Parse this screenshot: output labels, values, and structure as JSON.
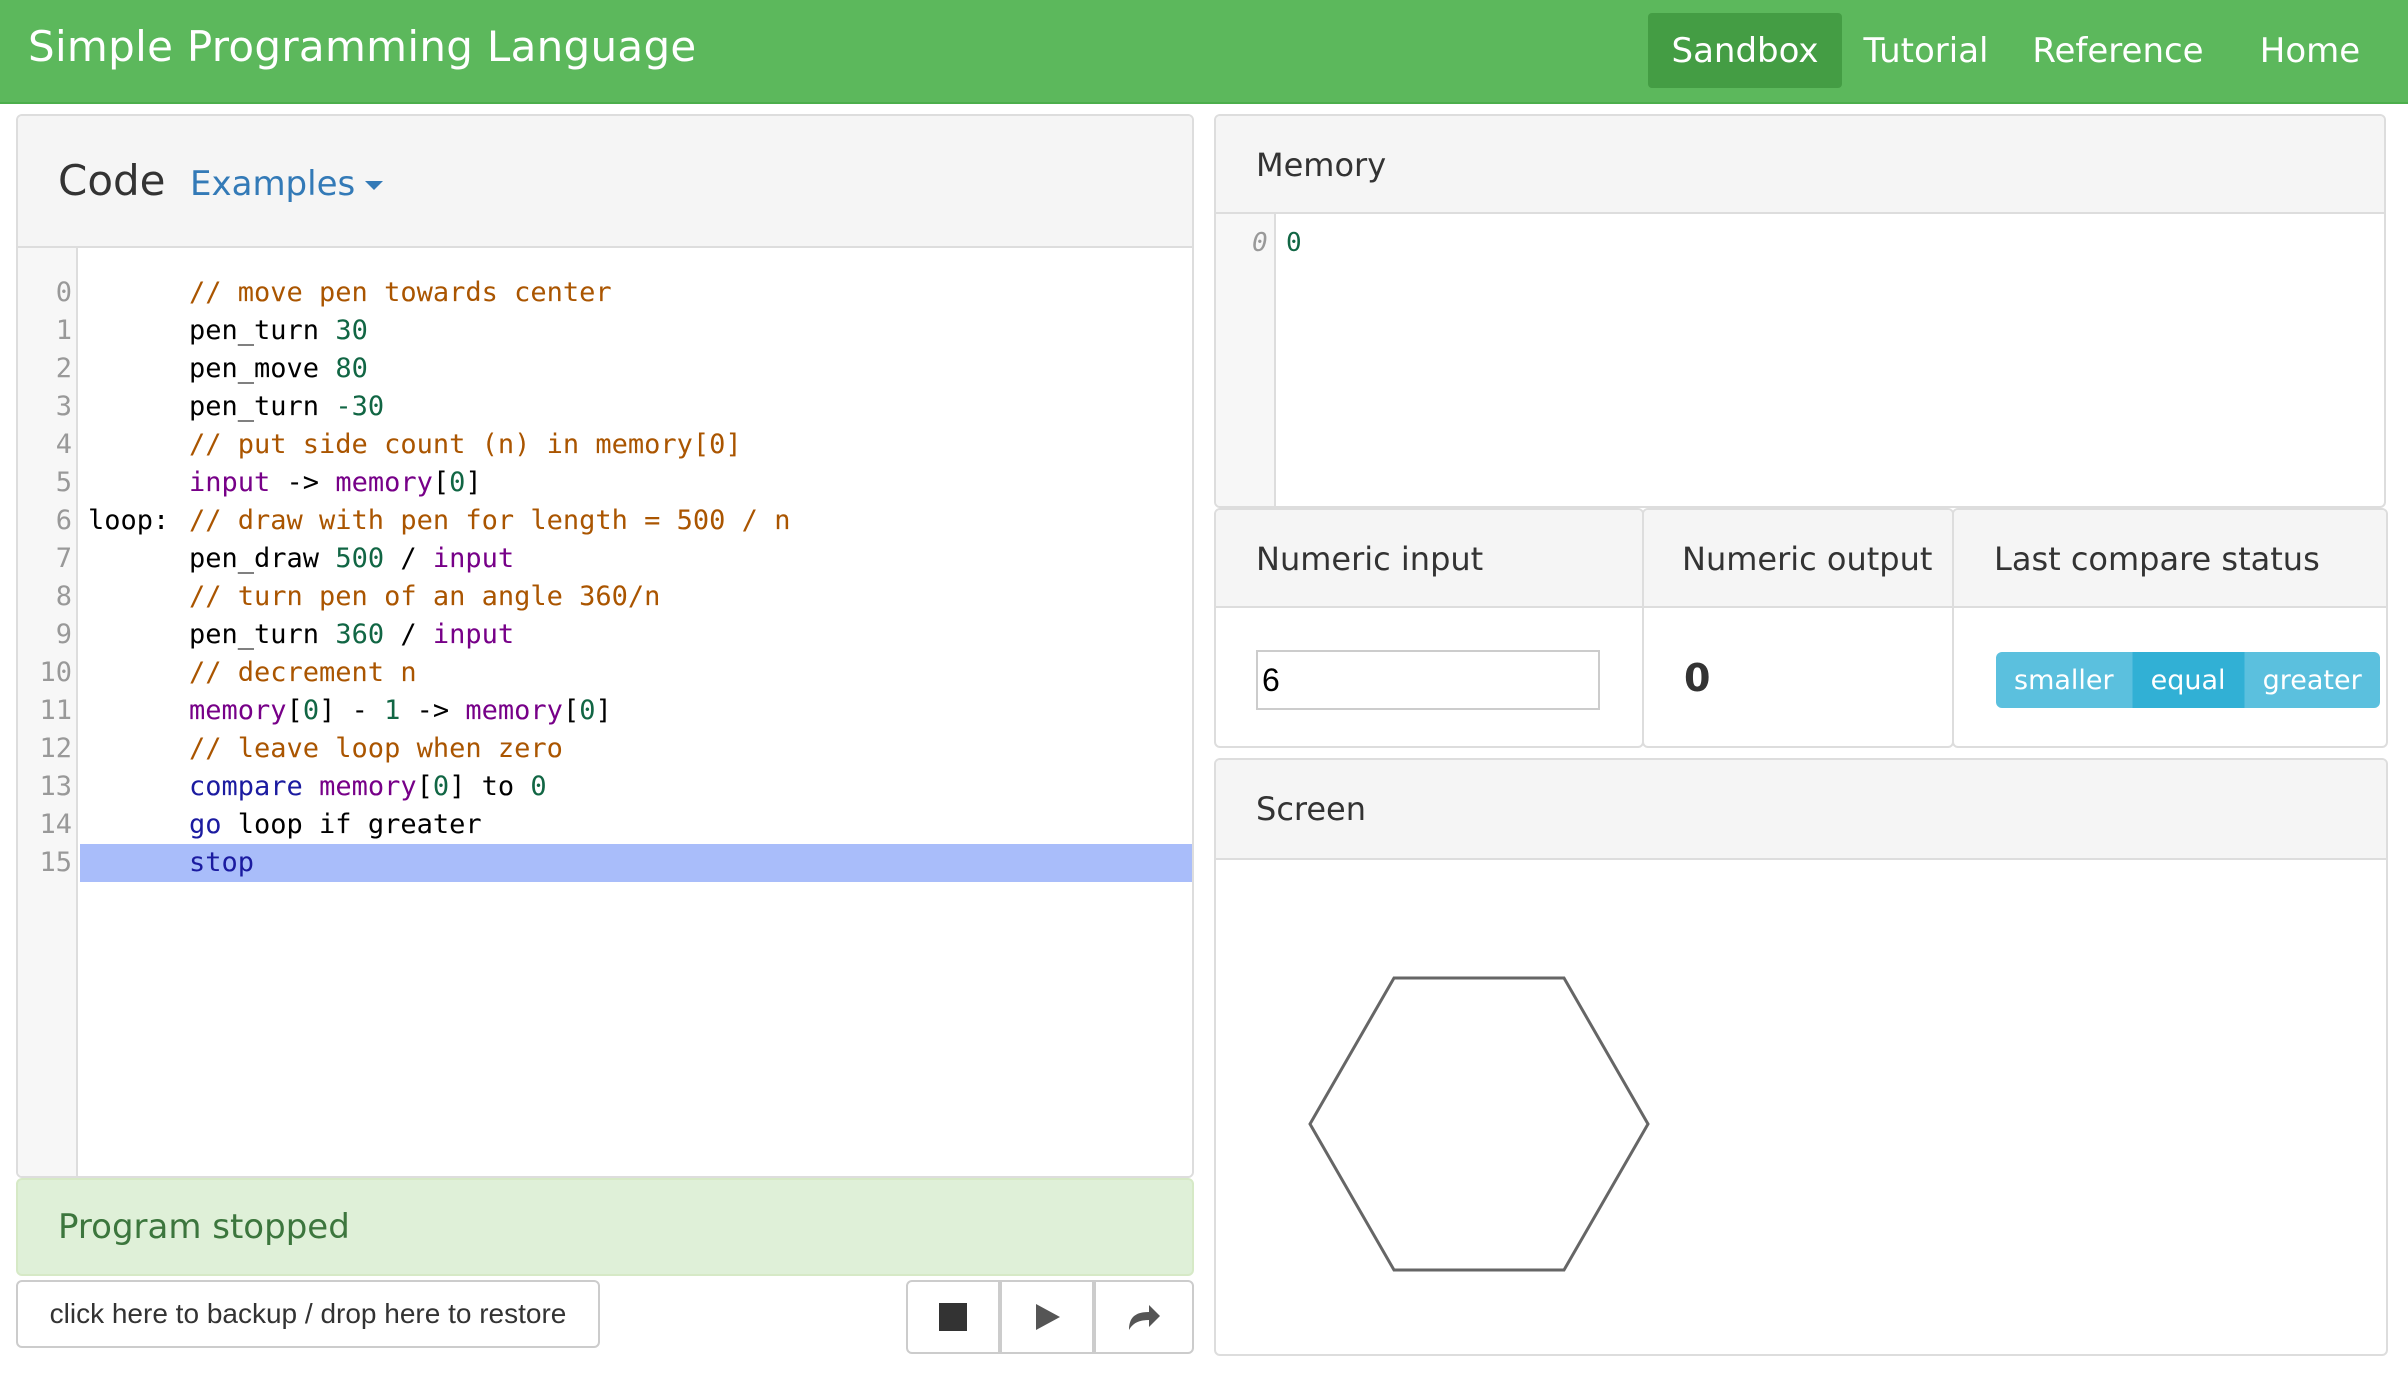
{
  "navbar": {
    "brand": "Simple Programming Language",
    "items": [
      {
        "label": "Sandbox",
        "active": true
      },
      {
        "label": "Tutorial",
        "active": false
      },
      {
        "label": "Reference",
        "active": false
      },
      {
        "label": "Home",
        "active": false
      }
    ]
  },
  "code_panel": {
    "title": "Code",
    "examples_label": "Examples",
    "current_line": 15,
    "lines": [
      {
        "num": "0",
        "label": "",
        "tokens": [
          [
            "comment",
            "// move pen towards center"
          ]
        ]
      },
      {
        "num": "1",
        "label": "",
        "tokens": [
          [
            "plain",
            "pen_turn "
          ],
          [
            "number",
            "30"
          ]
        ]
      },
      {
        "num": "2",
        "label": "",
        "tokens": [
          [
            "plain",
            "pen_move "
          ],
          [
            "number",
            "80"
          ]
        ]
      },
      {
        "num": "3",
        "label": "",
        "tokens": [
          [
            "plain",
            "pen_turn "
          ],
          [
            "number",
            "-30"
          ]
        ]
      },
      {
        "num": "4",
        "label": "",
        "tokens": [
          [
            "comment",
            "// put side count (n) in memory[0]"
          ]
        ]
      },
      {
        "num": "5",
        "label": "",
        "tokens": [
          [
            "var",
            "input"
          ],
          [
            "plain",
            " -> "
          ],
          [
            "var",
            "memory"
          ],
          [
            "plain",
            "["
          ],
          [
            "number",
            "0"
          ],
          [
            "plain",
            "]"
          ]
        ]
      },
      {
        "num": "6",
        "label": "loop:",
        "tokens": [
          [
            "comment",
            "// draw with pen for length = 500 / n"
          ]
        ]
      },
      {
        "num": "7",
        "label": "",
        "tokens": [
          [
            "plain",
            "pen_draw "
          ],
          [
            "number",
            "500"
          ],
          [
            "plain",
            " / "
          ],
          [
            "var",
            "input"
          ]
        ]
      },
      {
        "num": "8",
        "label": "",
        "tokens": [
          [
            "comment",
            "// turn pen of an angle 360/n"
          ]
        ]
      },
      {
        "num": "9",
        "label": "",
        "tokens": [
          [
            "plain",
            "pen_turn "
          ],
          [
            "number",
            "360"
          ],
          [
            "plain",
            " / "
          ],
          [
            "var",
            "input"
          ]
        ]
      },
      {
        "num": "10",
        "label": "",
        "tokens": [
          [
            "comment",
            "// decrement n"
          ]
        ]
      },
      {
        "num": "11",
        "label": "",
        "tokens": [
          [
            "var",
            "memory"
          ],
          [
            "plain",
            "["
          ],
          [
            "number",
            "0"
          ],
          [
            "plain",
            "] - "
          ],
          [
            "number",
            "1"
          ],
          [
            "plain",
            " -> "
          ],
          [
            "var",
            "memory"
          ],
          [
            "plain",
            "["
          ],
          [
            "number",
            "0"
          ],
          [
            "plain",
            "]"
          ]
        ]
      },
      {
        "num": "12",
        "label": "",
        "tokens": [
          [
            "comment",
            "// leave loop when zero"
          ]
        ]
      },
      {
        "num": "13",
        "label": "",
        "tokens": [
          [
            "keyword",
            "compare"
          ],
          [
            "plain",
            " "
          ],
          [
            "var",
            "memory"
          ],
          [
            "plain",
            "["
          ],
          [
            "number",
            "0"
          ],
          [
            "plain",
            "] to "
          ],
          [
            "number",
            "0"
          ]
        ]
      },
      {
        "num": "14",
        "label": "",
        "tokens": [
          [
            "keyword",
            "go"
          ],
          [
            "plain",
            " loop if greater"
          ]
        ]
      },
      {
        "num": "15",
        "label": "",
        "tokens": [
          [
            "keyword",
            "stop"
          ]
        ]
      }
    ]
  },
  "status": {
    "text": "Program stopped"
  },
  "controls": {
    "backup_label": "click here to backup / drop here to restore",
    "buttons": [
      "stop-icon",
      "play-icon",
      "step-icon"
    ]
  },
  "memory": {
    "title": "Memory",
    "rows": [
      {
        "index": "0",
        "value": "0"
      }
    ]
  },
  "numeric_input": {
    "title": "Numeric input",
    "value": "6"
  },
  "numeric_output": {
    "title": "Numeric output",
    "value": "0"
  },
  "compare": {
    "title": "Last compare status",
    "options": [
      "smaller",
      "equal",
      "greater"
    ],
    "selected": "equal"
  },
  "screen": {
    "title": "Screen",
    "shape": "hexagon",
    "stroke_color": "#666666"
  },
  "colors": {
    "navbar": "#5cb85c",
    "navbar_active": "#449d44",
    "current_line_highlight": "#a9bdfa",
    "status_bg": "#dff0d8",
    "status_text": "#3c763d",
    "compare_button": "#5bc0de",
    "compare_active": "#31b0d5"
  }
}
